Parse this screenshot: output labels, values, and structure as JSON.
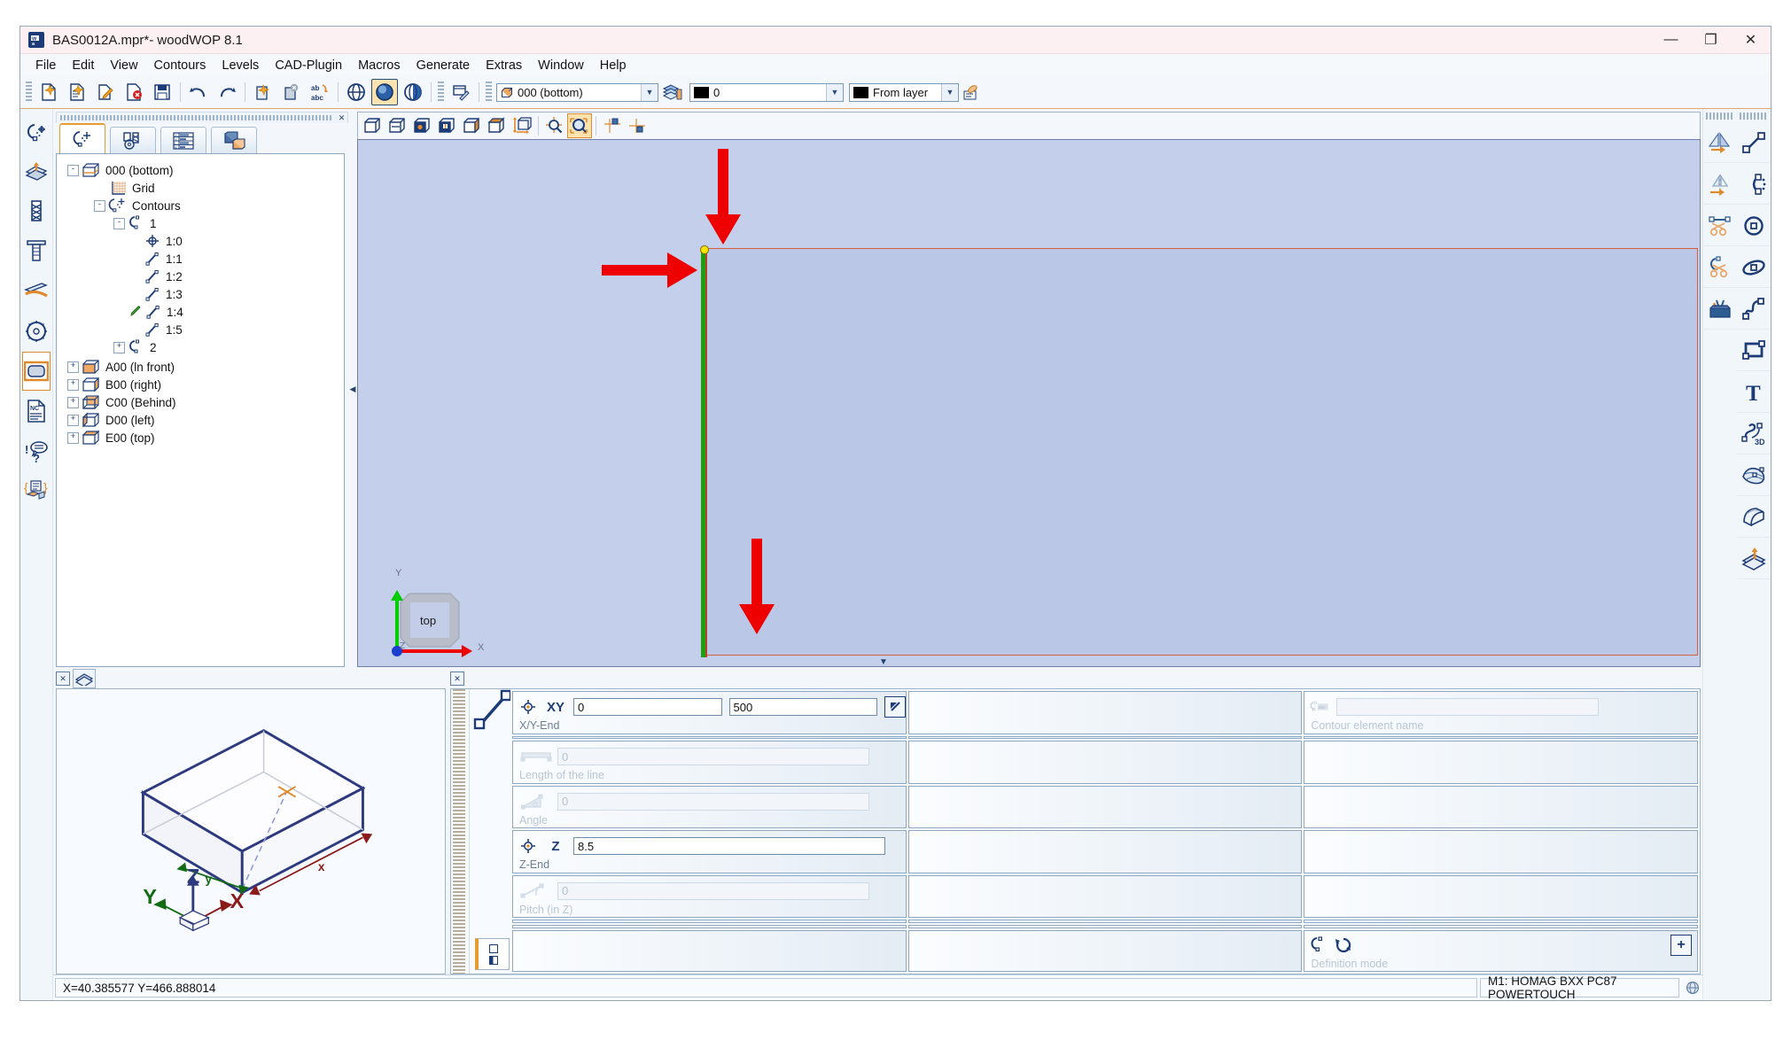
{
  "window": {
    "title": "BAS0012A.mpr*- woodWOP 8.1",
    "app_icon": "woodwop-icon",
    "minimize": "—",
    "maximize": "❐",
    "close": "✕"
  },
  "menubar": {
    "items": [
      {
        "label": "File",
        "accel": "F"
      },
      {
        "label": "Edit",
        "accel": "E"
      },
      {
        "label": "View",
        "accel": "V"
      },
      {
        "label": "Contours",
        "accel": "n"
      },
      {
        "label": "Levels",
        "accel": "L"
      },
      {
        "label": "CAD-Plugin",
        "accel": "C"
      },
      {
        "label": "Macros",
        "accel": "M"
      },
      {
        "label": "Generate",
        "accel": "a"
      },
      {
        "label": "Extras",
        "accel": "E"
      },
      {
        "label": "Window",
        "accel": ""
      },
      {
        "label": "Help",
        "accel": "H"
      }
    ]
  },
  "toolbar": {
    "buttons": [
      {
        "name": "new-file-icon",
        "title": "New"
      },
      {
        "name": "new-from-template-icon",
        "title": "New from template"
      },
      {
        "name": "open-file-icon",
        "title": "Open"
      },
      {
        "name": "close-file-icon",
        "title": "Close"
      },
      {
        "name": "save-icon",
        "title": "Save"
      },
      {
        "name": "undo-icon",
        "title": "Undo"
      },
      {
        "name": "redo-icon",
        "title": "Redo"
      },
      {
        "name": "copy-variant-icon",
        "title": "Copy"
      },
      {
        "name": "delete-variant-icon",
        "title": "Delete"
      },
      {
        "name": "abc-replace-icon",
        "title": "Replace text"
      },
      {
        "name": "globe-wireframe-icon",
        "title": "Wireframe view"
      },
      {
        "name": "globe-solid-icon",
        "title": "Solid view"
      },
      {
        "name": "globe-shaded-icon",
        "title": "Shaded view"
      },
      {
        "name": "edit-table-icon",
        "title": "Table editor"
      }
    ],
    "selected_button": "globe-solid-icon",
    "level_combo": {
      "value": "000  (bottom)",
      "icon": "level-cube-icon"
    },
    "levels_button": "levels-stack-icon",
    "layer_combo": {
      "value": "0",
      "swatch": "#000000"
    },
    "color_combo": {
      "value": "From layer",
      "swatch": "#000000"
    },
    "properties_button": "properties-hand-icon"
  },
  "left_toolbar": {
    "buttons": [
      {
        "name": "contour-tool-icon",
        "title": "Contour"
      },
      {
        "name": "pocket-tool-icon",
        "title": "Pocket"
      },
      {
        "name": "drill-bit-icon",
        "title": "Drilling"
      },
      {
        "name": "milling-tool-icon",
        "title": "Milling"
      },
      {
        "name": "grooving-tool-icon",
        "title": "Grooving"
      },
      {
        "name": "saw-blade-icon",
        "title": "Sawing"
      },
      {
        "name": "component-frame-icon",
        "title": "Component"
      },
      {
        "name": "nc-document-icon",
        "title": "NC macro"
      },
      {
        "name": "help-query-icon",
        "title": "Variables / query"
      },
      {
        "name": "variables-list-icon",
        "title": "Variables list"
      }
    ],
    "selected": "component-frame-icon"
  },
  "right_toolbar": {
    "column_one": [
      {
        "name": "mirror-copy-icon",
        "title": "Mirror copy"
      },
      {
        "name": "mirror-icon",
        "title": "Mirror"
      },
      {
        "name": "trim-line-icon",
        "title": "Trim"
      },
      {
        "name": "trim-contour-icon",
        "title": "Trim contour"
      },
      {
        "name": "toolbox-icon",
        "title": "Tool box"
      }
    ],
    "column_two": [
      {
        "name": "line-icon",
        "title": "Line"
      },
      {
        "name": "arc-icon",
        "title": "Arc"
      },
      {
        "name": "circle-icon",
        "title": "Circle"
      },
      {
        "name": "ellipse-icon",
        "title": "Ellipse"
      },
      {
        "name": "spline-icon",
        "title": "Spline"
      },
      {
        "name": "rectangle-icon",
        "title": "Rectangle"
      },
      {
        "name": "text-icon",
        "title": "Text"
      },
      {
        "name": "spline-3d-icon",
        "title": "3D spline"
      },
      {
        "name": "freeform-surface-icon",
        "title": "Free form surface"
      },
      {
        "name": "curved-surface-icon",
        "title": "Curved surface"
      },
      {
        "name": "extrude-surface-icon",
        "title": "Extrude"
      }
    ]
  },
  "tree_panel": {
    "close_icon": "close-icon",
    "tabs": [
      {
        "name": "tab-contours",
        "icon": "contour-tab-icon",
        "active": true
      },
      {
        "name": "tab-machining",
        "icon": "machining-tab-icon",
        "active": false
      },
      {
        "name": "tab-workpiece",
        "icon": "workpiece-table-icon",
        "active": false
      },
      {
        "name": "tab-components",
        "icon": "components-tab-icon",
        "active": false
      }
    ],
    "nodes": [
      {
        "label": "000 (bottom)",
        "indent": 0,
        "toggle": "-",
        "icon": "level-cube-icon"
      },
      {
        "label": "Grid",
        "indent": 1,
        "toggle": "",
        "icon": "grid-icon"
      },
      {
        "label": "Contours",
        "indent": 1,
        "toggle": "-",
        "icon": "contours-icon"
      },
      {
        "label": "1",
        "indent": 2,
        "toggle": "-",
        "icon": "contour-icon"
      },
      {
        "label": "1:0",
        "indent": 3,
        "toggle": "",
        "icon": "start-point-icon"
      },
      {
        "label": "1:1",
        "indent": 3,
        "toggle": "",
        "icon": "line-element-icon"
      },
      {
        "label": "1:2",
        "indent": 3,
        "toggle": "",
        "icon": "line-element-icon"
      },
      {
        "label": "1:3",
        "indent": 3,
        "toggle": "",
        "icon": "line-element-icon"
      },
      {
        "label": "1:4",
        "indent": 3,
        "toggle": "",
        "icon": "line-element-icon",
        "edit": true
      },
      {
        "label": "1:5",
        "indent": 3,
        "toggle": "",
        "icon": "line-element-icon"
      },
      {
        "label": "2",
        "indent": 2,
        "toggle": "+",
        "icon": "contour-icon"
      },
      {
        "label": "A00 (ln front)",
        "indent": 0,
        "toggle": "+",
        "icon": "level-cube-front-icon"
      },
      {
        "label": "B00 (right)",
        "indent": 0,
        "toggle": "+",
        "icon": "level-cube-right-icon"
      },
      {
        "label": "C00 (Behind)",
        "indent": 0,
        "toggle": "+",
        "icon": "level-cube-behind-icon"
      },
      {
        "label": "D00 (left)",
        "indent": 0,
        "toggle": "+",
        "icon": "level-cube-left-icon"
      },
      {
        "label": "E00 (top)",
        "indent": 0,
        "toggle": "+",
        "icon": "level-cube-top-icon"
      }
    ]
  },
  "view_toolbar": {
    "buttons": [
      {
        "name": "view-wireframe-icon",
        "title": "Wireframe"
      },
      {
        "name": "view-hidden-line-icon",
        "title": "Hidden line"
      },
      {
        "name": "view-front-icon",
        "title": "Front view"
      },
      {
        "name": "view-left-icon",
        "title": "Left view"
      },
      {
        "name": "view-right-icon",
        "title": "Right view"
      },
      {
        "name": "view-top-icon",
        "title": "Top view"
      },
      {
        "name": "view-rotate-icon",
        "title": "Rotate"
      },
      {
        "name": "zoom-pan-icon",
        "title": "Zoom / pan"
      },
      {
        "name": "zoom-window-icon",
        "title": "Zoom window",
        "selected": true
      },
      {
        "name": "snap-grid-icon",
        "title": "Snap grid"
      },
      {
        "name": "snap-corner-icon",
        "title": "Snap corner"
      }
    ]
  },
  "viewport": {
    "orientation_cube": {
      "face_label": "top",
      "x_axis": "X",
      "y_axis": "Y",
      "z_axis": "Z"
    },
    "workpiece_outline_color": "#d4603c",
    "selected_edge_color": "#1ca00f",
    "annotation_arrow_color": "#ee0000",
    "background_color": "#c3cfeb",
    "annotations": [
      {
        "name": "arrow-down-top",
        "direction": "down"
      },
      {
        "name": "arrow-right-left-edge",
        "direction": "right"
      },
      {
        "name": "arrow-down-y-field",
        "direction": "down"
      }
    ]
  },
  "preview_panel": {
    "close_icon": "close-icon",
    "view_icon": "shaded-view-icon",
    "axes": {
      "x": "X",
      "y": "Y",
      "z": "Z"
    },
    "dim_x_label": "x",
    "dim_y_label": "y"
  },
  "parameters": {
    "close_icon": "close-icon",
    "element_preview_icon": "line-element-icon",
    "rows": [
      {
        "name": "xy-end",
        "key": "XY",
        "icon": "target-point-icon",
        "label": "X/Y-End",
        "fields": [
          {
            "name": "x-end-input",
            "value": "0",
            "enabled": true
          },
          {
            "name": "y-end-input",
            "value": "500",
            "enabled": true
          }
        ],
        "pick_button": "pick-point-icon"
      },
      {
        "name": "length-of-line",
        "key": "",
        "icon": "length-icon",
        "label": "Length of the line",
        "fields": [
          {
            "name": "length-input",
            "value": "0",
            "enabled": false
          }
        ]
      },
      {
        "name": "angle",
        "key": "",
        "icon": "angle-icon",
        "label": "Angle",
        "fields": [
          {
            "name": "angle-input",
            "value": "0",
            "enabled": false
          }
        ]
      },
      {
        "name": "z-end",
        "key": "Z",
        "icon": "target-point-icon",
        "label": "Z-End",
        "fields": [
          {
            "name": "z-end-input",
            "value": "8.5",
            "enabled": true
          }
        ]
      },
      {
        "name": "pitch-in-z",
        "key": "",
        "icon": "pitch-icon",
        "label": "Pitch (in Z)",
        "fields": [
          {
            "name": "pitch-input",
            "value": "0",
            "enabled": false
          }
        ]
      }
    ],
    "contour_element_name": {
      "name": "contour-element-name",
      "icon": "contour-name-icon",
      "label": "Contour element name",
      "value": "",
      "enabled": false
    },
    "definition_mode": {
      "name": "definition-mode",
      "label": "Definition mode",
      "icons": [
        "definition-contour-icon",
        "definition-rotate-icon"
      ]
    },
    "expand_button": {
      "name": "expand-button",
      "glyph": "+"
    }
  },
  "statusbar": {
    "coordinates": "X=40.385577 Y=466.888014",
    "machine": "M1: HOMAG BXX PC87 POWERTOUCH",
    "right_icon": "status-globe-icon"
  }
}
